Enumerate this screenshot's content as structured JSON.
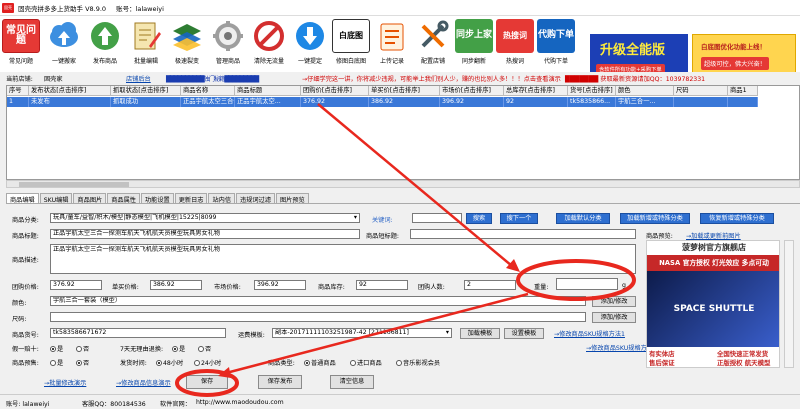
{
  "window": {
    "title": "固壳壳拼多多上货助手 V8.9.0",
    "account": "账号：lalaweiyi",
    "logo_text": "固壳"
  },
  "toolbar": {
    "faq": "常见问题",
    "items": [
      {
        "label": "常见问题"
      },
      {
        "label": "一键搬家"
      },
      {
        "label": "发布商品"
      },
      {
        "label": "批量编辑"
      },
      {
        "label": "极速裂变"
      },
      {
        "label": "管理商品"
      },
      {
        "label": "清除无流量"
      },
      {
        "label": "一键提定"
      },
      {
        "label": "修图白底图"
      },
      {
        "label": "上传记录"
      },
      {
        "label": "配置店铺"
      },
      {
        "label": "同步翻新"
      },
      {
        "label": "热搜词"
      },
      {
        "label": "代购下单"
      }
    ],
    "baidutu": "白底图",
    "sync": "同步上家",
    "hot": "热搜词",
    "daigou": "代购下单",
    "promo1_big": "升级全能版",
    "promo1_small": "含软件所有功能+采购下单",
    "promo2_a": "白底图优化功能上线！",
    "promo2_b": "超级可控，佛大兴奋！"
  },
  "infobar": {
    "shop_label": "当前店铺:",
    "shop_name": "固壳家",
    "shop_link": "店铺后台",
    "notice_left": "██████████独门秘籍█████████",
    "notice_mid": "→仔细学完这一讲，你将减少违规，可能举上我们别人少，赚的也比别人多！！！点击查看演示",
    "notice_right": "███████ 获取最新资源请加QQ：1039782331"
  },
  "grid": {
    "headers": [
      "序号",
      "发布状态[点击排序]",
      "抓取状态[点击排序]",
      "商品名称",
      "商品标题",
      "团购价[点击排序]",
      "单买价[点击排序]",
      "市场价[点击排序]",
      "总库存[点击排序]",
      "货号[点击排序]",
      "颜色",
      "尺码",
      "商品1"
    ],
    "row": [
      "1",
      "未发布",
      "抓取成功",
      "正品宇航太空三合一",
      "正品宇航太空...",
      "376.92",
      "386.92",
      "396.92",
      "92",
      "tk5835866...",
      "宇航三合一...",
      "",
      ""
    ]
  },
  "tabs": [
    "商品编辑",
    "SKU编辑",
    "商品图片",
    "商品属性",
    "功能设置",
    "更新日志",
    "站内信",
    "违规词过滤",
    "图片预览"
  ],
  "form": {
    "category_label": "商品分类:",
    "category_value": "玩具/童车/益智/积木/模型|静态模型|飞机模型|15225|8099",
    "keyword_label": "关键词:",
    "search_btn": "搜索",
    "next_btn": "搜下一个",
    "load_cat_btn": "加载默认分类",
    "load_new_btn": "加载新增或特殊分类",
    "restore_btn": "恢复新增或特殊分类",
    "title_label": "商品标题:",
    "title_value": "正品宇航太空三合一探测车航天飞机航天员模型玩具男女礼物",
    "short_title_label": "商品短标题:",
    "preview_label": "商品预览:",
    "preview_link": "→加载或更新前图片",
    "desc_label": "商品描述:",
    "desc_value": "正品宇航太空三合一探测车航天飞机航天员模型玩具男女礼物",
    "group_price_label": "团购价格:",
    "group_price": "376.92",
    "single_price_label": "单买价格:",
    "single_price": "386.92",
    "market_price_label": "市场价格:",
    "market_price": "396.92",
    "stock_label": "商品库存:",
    "stock": "92",
    "group_count_label": "团购人数:",
    "group_count": "2",
    "weight_label": "重量:",
    "weight_value": "",
    "weight_unit": "g",
    "color_label": "颜色:",
    "color_value": "宇航三合一套装（模型）",
    "color_btn": "添加/修改",
    "size_label": "尺码:",
    "size_value": "",
    "size_btn": "添加/修改",
    "sku_label": "商品货号:",
    "sku_value": "tk583586671672",
    "freight_label": "运费模板:",
    "freight_value": "副本-20171111103251987-42 [271166811]",
    "load_tpl_btn": "加载模板",
    "set_tpl_btn": "设置模板",
    "sku_link1": "→修改商品SKU规格方法1",
    "sku_link2": "→修改商品SKU规格方法2",
    "fake_label": "假一赔十:",
    "yes": "是",
    "no": "否",
    "refund_label": "7天无理由退换:",
    "presale_label": "商品预售:",
    "ship_label": "发货时间:",
    "ship_48": "48小时",
    "ship_24": "24小时",
    "type_label": "商品类型:",
    "type_normal": "普通商品",
    "type_import": "进口商品",
    "type_music": "音乐影视会员"
  },
  "actions": {
    "demo_link": "→批量修改演示",
    "modify_link": "→修改商品信息演示",
    "save": "保存",
    "save_publish": "保存发布",
    "clear": "清空信息"
  },
  "ad": {
    "header": "菠萝树官方旗舰店",
    "slogan": "NASA 官方授权  灯光效应  多点可动",
    "image_text": "SPACE SHUTTLE",
    "line1": "有实体店",
    "line1b": "售后保证",
    "line2": "全国快速正常发货",
    "line2b": "正版授权 航天模型"
  },
  "status": {
    "account": "账号: lalaweiyi",
    "qq": "客服QQ：800184536",
    "site_label": "软件官网：",
    "site": "http://www.maodoudou.com"
  },
  "overlay_color": "#e8281e"
}
